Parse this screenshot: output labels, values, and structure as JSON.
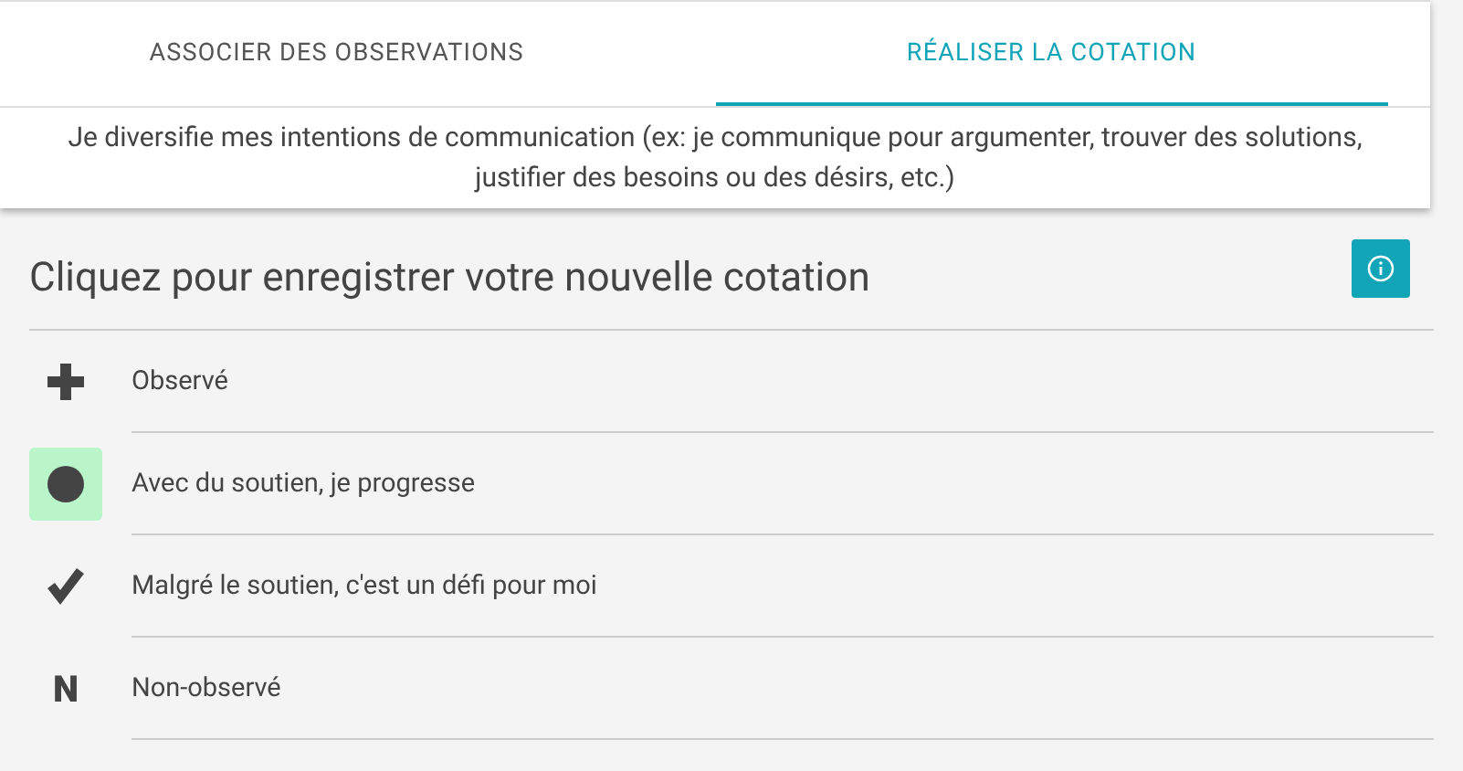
{
  "tabs": [
    {
      "label": "ASSOCIER DES OBSERVATIONS",
      "selected": false
    },
    {
      "label": "RÉALISER LA COTATION",
      "selected": true
    }
  ],
  "description": "Je diversifie mes intentions de communication (ex: je communique pour argumenter, trouver des solutions, justifier des besoins ou des désirs, etc.)",
  "heading": "Cliquez pour enregistrer votre nouvelle cotation",
  "options": [
    {
      "kind": "plus",
      "label": "Observé",
      "selected": false
    },
    {
      "kind": "dot",
      "label": "Avec du soutien, je progresse",
      "selected": true
    },
    {
      "kind": "check",
      "label": "Malgré le soutien, c'est un défi pour moi",
      "selected": false
    },
    {
      "kind": "letter",
      "symbol": "N",
      "label": "Non-observé",
      "selected": false
    }
  ]
}
